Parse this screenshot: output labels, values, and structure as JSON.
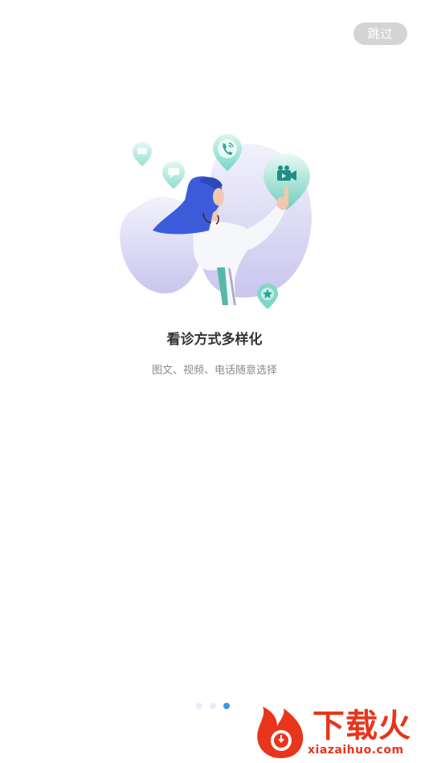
{
  "skip_label": "跳过",
  "onboarding": {
    "title": "看诊方式多样化",
    "subtitle": "图文、视频、电话随意选择"
  },
  "pager": {
    "total": 3,
    "active_index": 2
  },
  "watermark": {
    "title": "下载火",
    "url": "xiazaihuo.com"
  },
  "colors": {
    "accent": "#3a96e6",
    "teal": "#6fd3c2",
    "hair": "#3b5bdb",
    "blob": "#e6e4f8"
  },
  "icons": [
    "chat-pin-icon",
    "message-pin-icon",
    "phone-pin-icon",
    "video-pin-icon",
    "star-pin-icon"
  ]
}
